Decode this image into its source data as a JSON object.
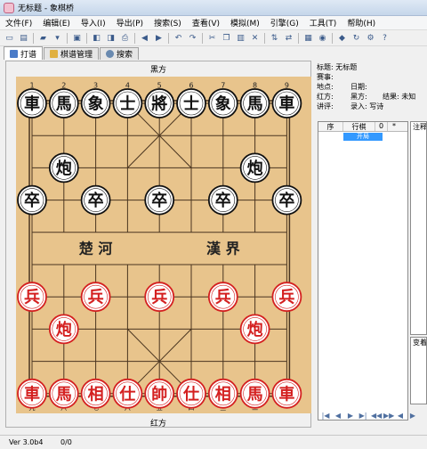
{
  "window": {
    "title": "无标题 - 象棋桥"
  },
  "menu": [
    "文件(F)",
    "编辑(E)",
    "导入(I)",
    "导出(P)",
    "搜索(S)",
    "查看(V)",
    "模拟(M)",
    "引擎(G)",
    "工具(T)",
    "帮助(H)"
  ],
  "toolbar": {
    "buttons": [
      {
        "name": "new-icon",
        "glyph": "▭"
      },
      {
        "name": "new-board-icon",
        "glyph": "▤"
      },
      {
        "name": "open-icon",
        "glyph": "▰"
      },
      {
        "name": "open-dropdown-icon",
        "glyph": "▾"
      },
      {
        "name": "save-icon",
        "glyph": "▣"
      },
      {
        "name": "import-icon",
        "glyph": "◧"
      },
      {
        "name": "export-icon",
        "glyph": "◨"
      },
      {
        "name": "print-icon",
        "glyph": "⎙"
      },
      {
        "name": "back-icon",
        "glyph": "◀"
      },
      {
        "name": "forward-icon",
        "glyph": "▶"
      },
      {
        "name": "undo-icon",
        "glyph": "↶"
      },
      {
        "name": "redo-icon",
        "glyph": "↷"
      },
      {
        "name": "cut-icon",
        "glyph": "✂"
      },
      {
        "name": "copy-icon",
        "glyph": "❐"
      },
      {
        "name": "paste-icon",
        "glyph": "▥"
      },
      {
        "name": "delete-icon",
        "glyph": "✕"
      },
      {
        "name": "flip-vertical-icon",
        "glyph": "⇅"
      },
      {
        "name": "flip-horizontal-icon",
        "glyph": "⇄"
      },
      {
        "name": "board-view-icon",
        "glyph": "▦"
      },
      {
        "name": "engine-icon",
        "glyph": "◉"
      },
      {
        "name": "analyze-icon",
        "glyph": "◆"
      },
      {
        "name": "refresh-icon",
        "glyph": "↻"
      },
      {
        "name": "options-icon",
        "glyph": "⚙"
      },
      {
        "name": "help-icon",
        "glyph": "?"
      }
    ]
  },
  "tabs": [
    {
      "label": "打谱",
      "icon": "record-icon",
      "active": true
    },
    {
      "label": "棋谱管理",
      "icon": "folder-icon",
      "active": false
    },
    {
      "label": "搜索",
      "icon": "search-icon",
      "active": false
    }
  ],
  "board": {
    "top_label": "黑方",
    "bottom_label": "红方",
    "river_left": "楚  河",
    "river_right": "漢  界",
    "top_files": [
      "1",
      "2",
      "3",
      "4",
      "5",
      "6",
      "7",
      "8",
      "9"
    ],
    "bottom_files": [
      "九",
      "八",
      "七",
      "六",
      "五",
      "四",
      "三",
      "二",
      "一"
    ],
    "black_pieces": [
      {
        "c": "車",
        "col": 0,
        "row": 0
      },
      {
        "c": "馬",
        "col": 1,
        "row": 0
      },
      {
        "c": "象",
        "col": 2,
        "row": 0
      },
      {
        "c": "士",
        "col": 3,
        "row": 0
      },
      {
        "c": "將",
        "col": 4,
        "row": 0
      },
      {
        "c": "士",
        "col": 5,
        "row": 0
      },
      {
        "c": "象",
        "col": 6,
        "row": 0
      },
      {
        "c": "馬",
        "col": 7,
        "row": 0
      },
      {
        "c": "車",
        "col": 8,
        "row": 0
      },
      {
        "c": "炮",
        "col": 1,
        "row": 2
      },
      {
        "c": "炮",
        "col": 7,
        "row": 2
      },
      {
        "c": "卒",
        "col": 0,
        "row": 3
      },
      {
        "c": "卒",
        "col": 2,
        "row": 3
      },
      {
        "c": "卒",
        "col": 4,
        "row": 3
      },
      {
        "c": "卒",
        "col": 6,
        "row": 3
      },
      {
        "c": "卒",
        "col": 8,
        "row": 3
      }
    ],
    "red_pieces": [
      {
        "c": "兵",
        "col": 0,
        "row": 6
      },
      {
        "c": "兵",
        "col": 2,
        "row": 6
      },
      {
        "c": "兵",
        "col": 4,
        "row": 6
      },
      {
        "c": "兵",
        "col": 6,
        "row": 6
      },
      {
        "c": "兵",
        "col": 8,
        "row": 6
      },
      {
        "c": "炮",
        "col": 1,
        "row": 7
      },
      {
        "c": "炮",
        "col": 7,
        "row": 7
      },
      {
        "c": "車",
        "col": 0,
        "row": 9
      },
      {
        "c": "馬",
        "col": 1,
        "row": 9
      },
      {
        "c": "相",
        "col": 2,
        "row": 9
      },
      {
        "c": "仕",
        "col": 3,
        "row": 9
      },
      {
        "c": "帥",
        "col": 4,
        "row": 9
      },
      {
        "c": "仕",
        "col": 5,
        "row": 9
      },
      {
        "c": "相",
        "col": 6,
        "row": 9
      },
      {
        "c": "馬",
        "col": 7,
        "row": 9
      },
      {
        "c": "車",
        "col": 8,
        "row": 9
      }
    ],
    "colors": {
      "wood": "#e8c48c",
      "line": "#4a3520",
      "red": "#d42020",
      "black": "#111111"
    }
  },
  "info": {
    "title": "标题: 无标题",
    "event": "赛事:",
    "place": "地点:",
    "date": "日期:",
    "red": "红方:",
    "black": "黑方:",
    "result": "结果: 未知",
    "commentator": "讲评:",
    "recorder": "录入: 写诗"
  },
  "moves": {
    "headers": [
      "序",
      "行棋",
      "0",
      "*"
    ],
    "rows": [
      "开局"
    ]
  },
  "comment_label": "注释",
  "variation_label": "变着",
  "nav": [
    "|◀",
    "◀",
    "▶",
    "▶|",
    "◀◀",
    "▶▶",
    "◀",
    "▶"
  ],
  "status": {
    "version": "Ver 3.0b4",
    "count": "0/0"
  }
}
